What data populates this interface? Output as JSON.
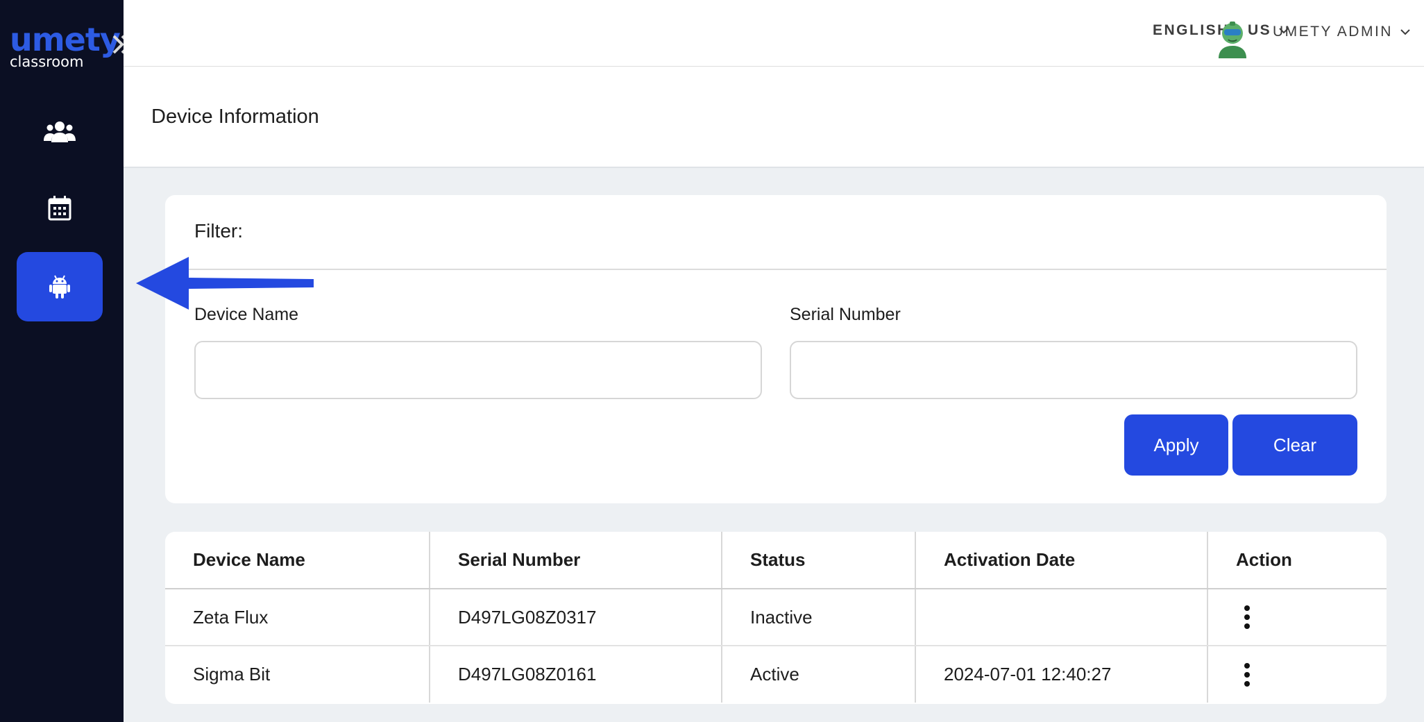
{
  "brand": {
    "name": "umety",
    "sub": "classroom"
  },
  "header": {
    "language": "ENGLISH - US",
    "user": "UMETY ADMIN"
  },
  "sidebar": {
    "items": [
      {
        "icon": "users-icon",
        "active": false
      },
      {
        "icon": "calendar-icon",
        "active": false
      },
      {
        "icon": "android-icon",
        "active": true
      }
    ]
  },
  "page": {
    "title": "Device Information"
  },
  "filter": {
    "label": "Filter:",
    "device_name_label": "Device Name",
    "device_name_value": "",
    "serial_number_label": "Serial Number",
    "serial_number_value": "",
    "apply_label": "Apply",
    "clear_label": "Clear"
  },
  "table": {
    "headers": [
      "Device Name",
      "Serial Number",
      "Status",
      "Activation Date",
      "Action"
    ],
    "rows": [
      {
        "device_name": "Zeta Flux",
        "serial_number": "D497LG08Z0317",
        "status": "Inactive",
        "activation_date": ""
      },
      {
        "device_name": "Sigma Bit",
        "serial_number": "D497LG08Z0161",
        "status": "Active",
        "activation_date": "2024-07-01 12:40:27"
      }
    ]
  },
  "colors": {
    "sidebar_bg": "#0b0f23",
    "accent": "#2449e0",
    "page_bg": "#edf0f3"
  }
}
